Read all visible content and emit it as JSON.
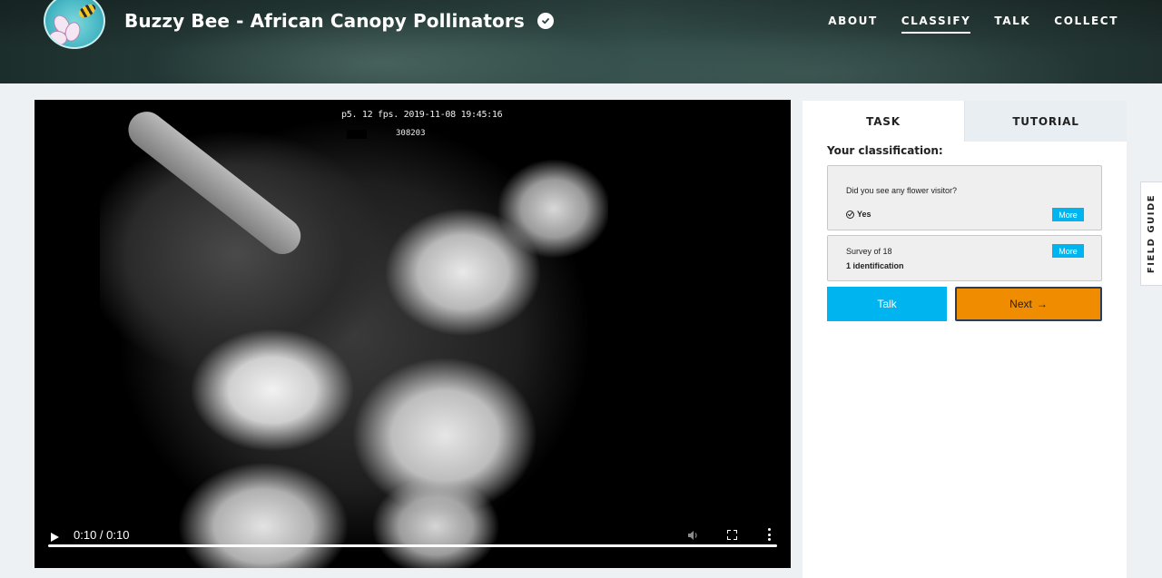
{
  "header": {
    "title": "Buzzy Bee - African Canopy Pollinators",
    "logo_icon": "bee-flower-logo",
    "verified_icon": "verified-check-icon",
    "nav": [
      {
        "label": "ABOUT",
        "active": false
      },
      {
        "label": "CLASSIFY",
        "active": true
      },
      {
        "label": "TALK",
        "active": false
      },
      {
        "label": "COLLECT",
        "active": false
      }
    ]
  },
  "media": {
    "overlay_line1": "p5. 12 fps. 2019-11-08 19:45:16",
    "overlay_line2": "308203",
    "time": "0:10 / 0:10",
    "progress": 1.0
  },
  "panel": {
    "tabs": [
      {
        "label": "TASK",
        "active": true
      },
      {
        "label": "TUTORIAL",
        "active": false
      }
    ],
    "classification_title": "Your classification:",
    "question": "Did you see any flower visitor?",
    "answer": "Yes",
    "more_label": "More",
    "survey_label": "Survey of 18",
    "identification": "1 identification",
    "talk_label": "Talk",
    "next_label": "Next",
    "colors": {
      "primary": "#00b4f0",
      "next": "#f08c00",
      "next_border": "#2b3d57"
    }
  },
  "field_guide_label": "FIELD GUIDE"
}
